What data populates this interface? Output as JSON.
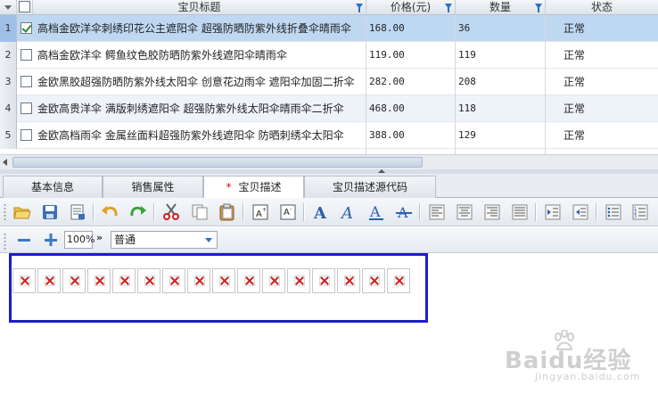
{
  "grid": {
    "headers": {
      "title": "宝贝标题",
      "price": "价格(元)",
      "qty": "数量",
      "status": "状态"
    },
    "rows": [
      {
        "num": "1",
        "checked": true,
        "title": "高档金欧洋伞刺绣印花公主遮阳伞 超强防晒防紫外线折叠伞晴雨伞",
        "price": "168.00",
        "qty": "36",
        "status": "正常"
      },
      {
        "num": "2",
        "checked": false,
        "title": "高档金欧洋伞  鳄鱼纹色胶防晒防紫外线遮阳伞晴雨伞",
        "price": "119.00",
        "qty": "119",
        "status": "正常"
      },
      {
        "num": "3",
        "checked": false,
        "title": "金欧黑胶超强防晒防紫外线太阳伞 创意花边雨伞 遮阳伞加固二折伞",
        "price": "282.00",
        "qty": "208",
        "status": "正常"
      },
      {
        "num": "4",
        "checked": false,
        "title": "金欧高贵洋伞 满版刺绣遮阳伞 超强防紫外线太阳伞晴雨伞二折伞",
        "price": "468.00",
        "qty": "118",
        "status": "正常"
      },
      {
        "num": "5",
        "checked": false,
        "title": "金欧高档雨伞 金属丝面料超强防紫外线遮阳伞 防晒刺绣伞太阳伞",
        "price": "388.00",
        "qty": "129",
        "status": "正常"
      }
    ]
  },
  "tabs": [
    {
      "label": "基本信息",
      "active": false,
      "star": ""
    },
    {
      "label": "销售属性",
      "active": false,
      "star": ""
    },
    {
      "label": "宝贝描述",
      "active": true,
      "star": "*"
    },
    {
      "label": "宝贝描述源代码",
      "active": false,
      "star": ""
    }
  ],
  "toolbar": {
    "buttons": [
      "open-icon",
      "save-icon",
      "properties-icon",
      "undo-icon",
      "redo-icon",
      "cut-icon",
      "copy-icon",
      "paste-icon",
      "superscript-icon",
      "subscript-icon",
      "bold-icon",
      "italic-icon",
      "underline-icon",
      "strikethrough-icon",
      "align-left-icon",
      "align-center-icon",
      "align-right-icon",
      "justify-icon",
      "indent-icon",
      "outdent-icon",
      "bullet-list-icon",
      "numbered-list-icon"
    ]
  },
  "format_bar": {
    "zoom_value": "100%",
    "chevron": "»",
    "style_value": "普通"
  },
  "editor": {
    "broken_image_count": 16
  },
  "watermark": {
    "brand": "Baidu经验",
    "url": "jingyan.baidu.com"
  },
  "colors": {
    "selected_row": "#bfd8f2",
    "highlight_border": "#1c1ccc",
    "broken_x": "#d52020",
    "icon_blue": "#2a70c9"
  }
}
